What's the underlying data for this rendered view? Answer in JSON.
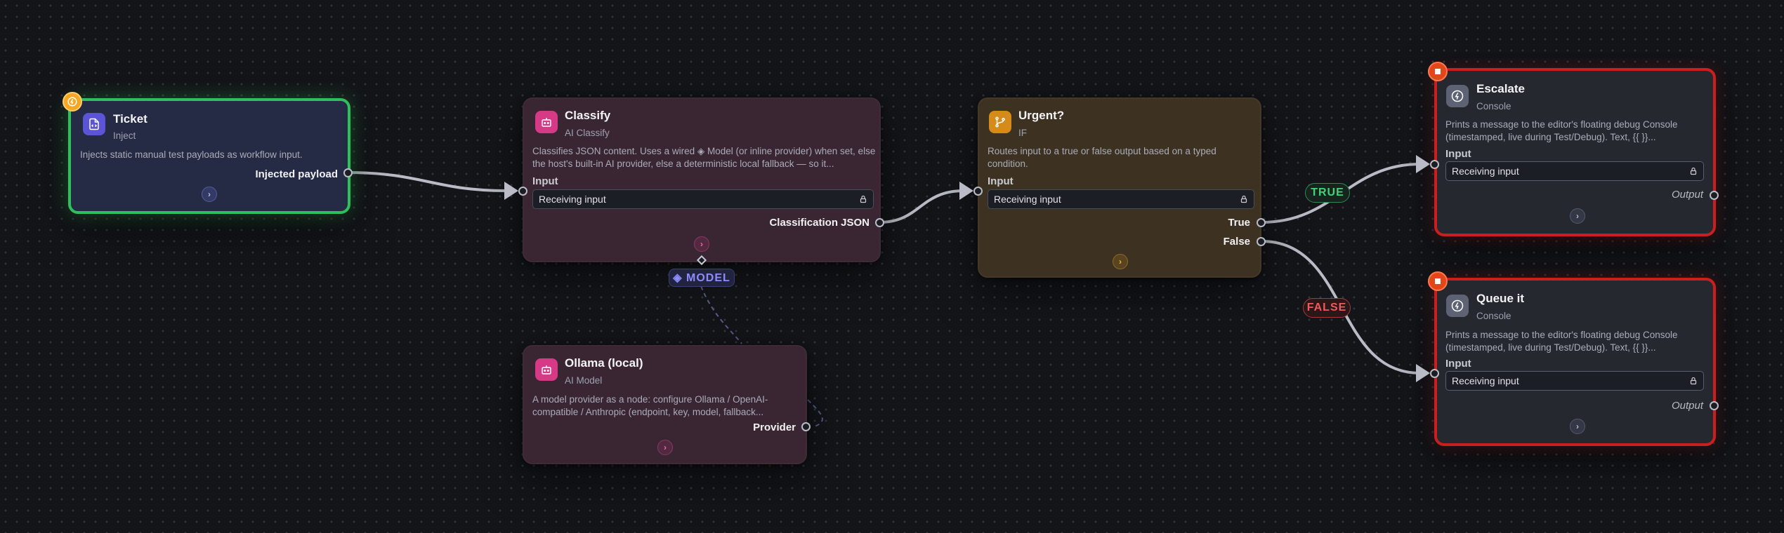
{
  "colors": {
    "inject_border": "#2fbf5b",
    "console_border": "#c9201f",
    "wire": "#b9bcc6",
    "true_green": "#3ed47a",
    "false_red": "#f05a5a",
    "model_purple": "#8d8cff"
  },
  "nodes": {
    "ticket": {
      "title": "Ticket",
      "type": "Inject",
      "description": "Injects static manual test payloads as workflow input.",
      "output_label": "Injected payload",
      "icon": "file-code-icon",
      "badge_icon": "lightning-icon"
    },
    "classify": {
      "title": "Classify",
      "type": "AI Classify",
      "description": "Classifies JSON content. Uses a wired ◈ Model (or inline provider) when set, else the host's built-in AI provider, else a deterministic local fallback — so it...",
      "input_section": "Input",
      "input_value": "Receiving input",
      "output_label": "Classification JSON",
      "icon": "robot-icon"
    },
    "ollama": {
      "title": "Ollama (local)",
      "type": "AI Model",
      "description": "A model provider as a node: configure Ollama / OpenAI-compatible / Anthropic (endpoint, key, model, fallback...",
      "output_label": "Provider",
      "icon": "robot-icon"
    },
    "urgent": {
      "title": "Urgent?",
      "type": "IF",
      "description": "Routes input to a true or false output based on a typed condition.",
      "input_section": "Input",
      "input_value": "Receiving input",
      "true_label": "True",
      "false_label": "False",
      "icon": "branch-icon"
    },
    "escalate": {
      "title": "Escalate",
      "type": "Console",
      "description": "Prints a message to the editor's floating debug Console (timestamped, live during Test/Debug). Text, {{ }}...",
      "input_section": "Input",
      "input_value": "Receiving input",
      "output_label": "Output",
      "icon": "lightning-icon",
      "badge_icon": "stop-icon"
    },
    "queue": {
      "title": "Queue it",
      "type": "Console",
      "description": "Prints a message to the editor's floating debug Console (timestamped, live during Test/Debug). Text, {{ }}...",
      "input_section": "Input",
      "input_value": "Receiving input",
      "output_label": "Output",
      "icon": "lightning-icon",
      "badge_icon": "stop-icon"
    }
  },
  "edge_labels": {
    "true": "TRUE",
    "false": "FALSE",
    "model": "◈ MODEL"
  }
}
